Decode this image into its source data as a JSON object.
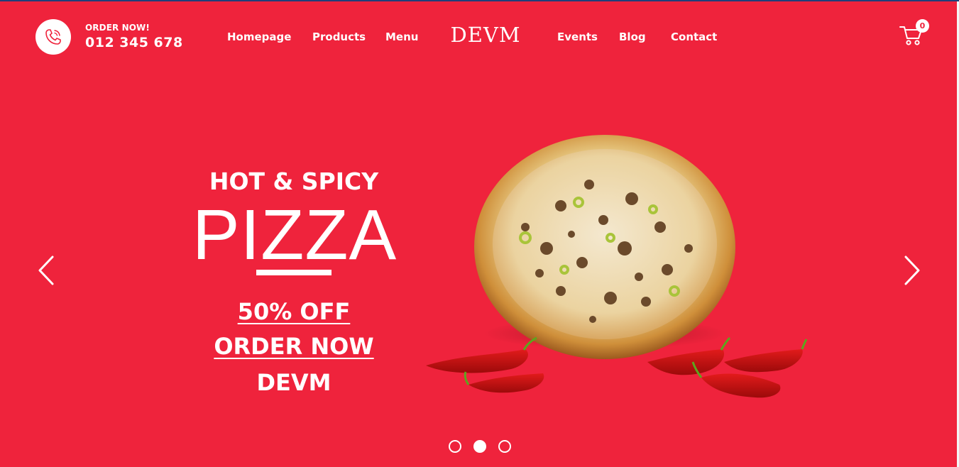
{
  "header": {
    "order_label": "ORDER NOW!",
    "phone_number": "012 345 678",
    "brand": "DEVM",
    "nav_left": [
      "Homepage",
      "Products",
      "Menu"
    ],
    "nav_right": [
      "Events",
      "Blog",
      "Contact"
    ],
    "cart_count": "0"
  },
  "hero": {
    "subtitle": "HOT & SPICY",
    "headline": "PIZZA",
    "discount": "50% OFF",
    "cta": "ORDER NOW",
    "brand_tag": "DEVM"
  },
  "slider": {
    "active_slide": 2,
    "slide_count": 3
  },
  "colors": {
    "hero_background": "#ef233c",
    "text": "#ffffff",
    "top_stripe": "#1f3f7a"
  },
  "icons": {
    "phone": "phone-icon",
    "cart": "cart-icon",
    "prev": "chevron-left-icon",
    "next": "chevron-right-icon"
  }
}
